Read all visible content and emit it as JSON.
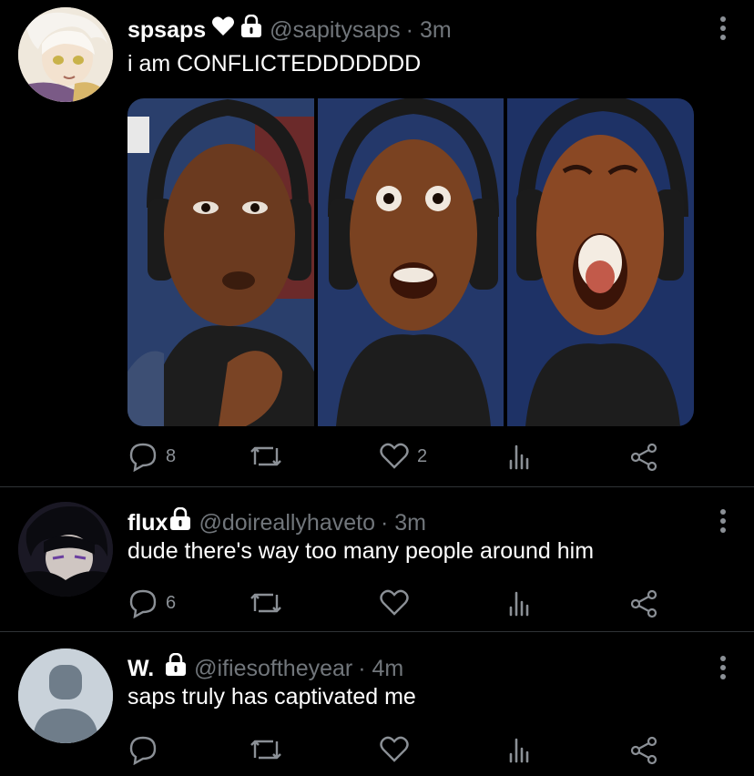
{
  "tweets": [
    {
      "name": "spsaps",
      "handle": "@sapitysaps",
      "time": "· 3m",
      "text": "i am CONFLICTEDDDDDDD",
      "reply_count": "8",
      "retweet_count": "",
      "like_count": "2",
      "avatar": "anime-girl-avatar"
    },
    {
      "name": "flux",
      "handle": "@doireallyhaveto",
      "time": "· 3m",
      "text": "dude there's way too many people around him",
      "reply_count": "6",
      "retweet_count": "",
      "like_count": "",
      "avatar": "anime-boy-avatar"
    },
    {
      "name": "W.",
      "handle": "@ifiesoftheyear",
      "time": "· 4m",
      "text": "saps truly has captivated me",
      "reply_count": "",
      "retweet_count": "",
      "like_count": "",
      "avatar": "default-avatar"
    }
  ],
  "colors": {
    "background": "#000000",
    "secondary_text": "#71767b",
    "icon": "#8b9096",
    "divider": "#2f3336"
  }
}
